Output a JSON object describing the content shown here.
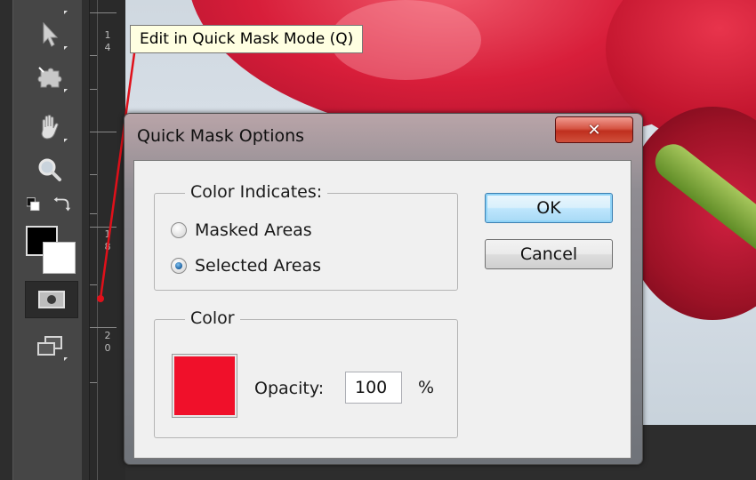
{
  "tooltip": {
    "text": "Edit in Quick Mask Mode (Q)"
  },
  "tools_panel": {
    "foreground_color": "#000000",
    "background_color": "#ffffff",
    "tools": [
      {
        "name": "move-tool",
        "icon": "arrow-icon"
      },
      {
        "name": "puppet-tool",
        "icon": "puzzle-icon"
      },
      {
        "name": "hand-tool",
        "icon": "hand-icon"
      },
      {
        "name": "zoom-tool",
        "icon": "magnifier-icon"
      },
      {
        "name": "quick-mask-tool",
        "icon": "quick-mask-icon",
        "active": true
      },
      {
        "name": "screen-mode-tool",
        "icon": "screen-mode-icon"
      }
    ]
  },
  "ruler": {
    "labels": [
      "1",
      "4",
      "1",
      "8",
      "2",
      "0"
    ]
  },
  "dialog": {
    "title": "Quick Mask Options",
    "close_label": "✕",
    "color_indicates": {
      "legend": "Color Indicates:",
      "options": [
        {
          "label": "Masked Areas",
          "checked": false
        },
        {
          "label": "Selected Areas",
          "checked": true
        }
      ]
    },
    "color_group": {
      "legend": "Color",
      "swatch_color": "#f0102a",
      "opacity_label": "Opacity:",
      "opacity_value": "100",
      "opacity_unit": "%"
    },
    "ok_label": "OK",
    "cancel_label": "Cancel"
  },
  "colors": {
    "annotation_line": "#e0101a",
    "tooltip_bg": "#ffffe1"
  }
}
